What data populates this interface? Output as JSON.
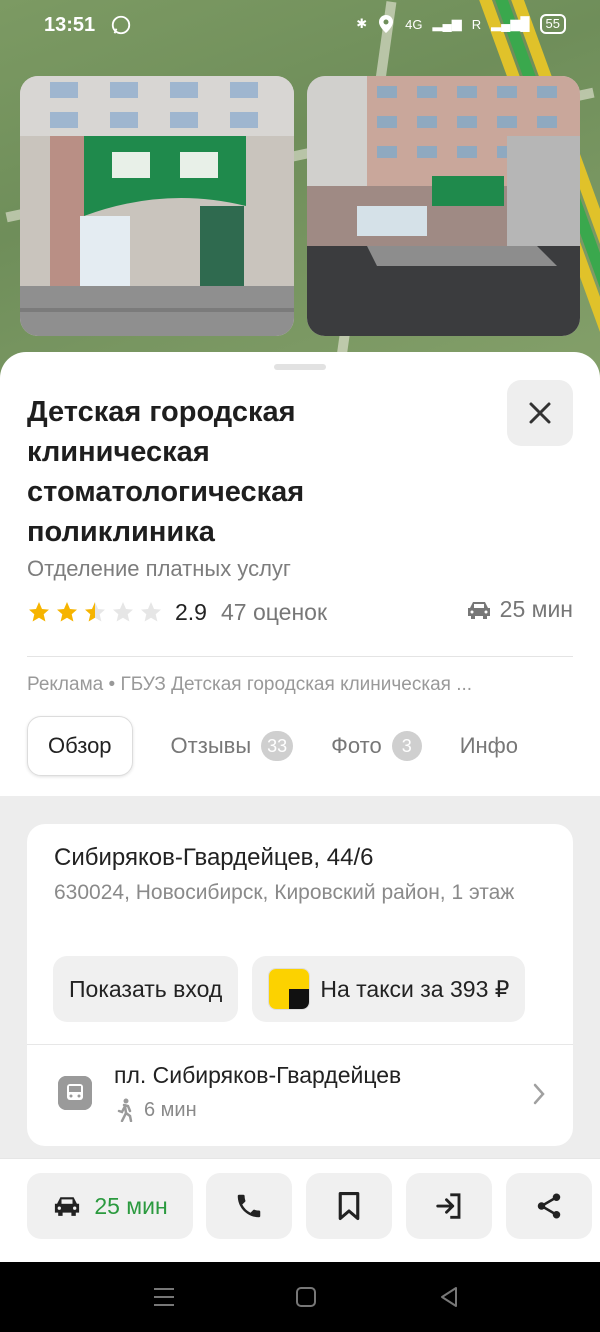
{
  "status_bar": {
    "time": "13:51",
    "network": "4G",
    "roaming": "R",
    "battery": "55"
  },
  "place": {
    "title": "Детская городская клиническая стоматологическая поликлиника",
    "subtitle": "Отделение платных услуг",
    "rating": "2.9",
    "rating_value": 2.5,
    "reviews": "47 оценок",
    "eta": "25 мин"
  },
  "ad": {
    "label": "Реклама",
    "text": "ГБУЗ Детская городская клиническая ..."
  },
  "tabs": [
    {
      "label": "Обзор"
    },
    {
      "label": "Отзывы",
      "badge": "33"
    },
    {
      "label": "Фото",
      "badge": "3"
    },
    {
      "label": "Инфо"
    }
  ],
  "address": {
    "street": "Сибиряков-Гвардейцев, 44/6",
    "details": "630024, Новосибирск, Кировский район, 1 этаж",
    "show_entrance": "Показать вход",
    "taxi": "На такси за 393 ₽"
  },
  "transit": {
    "stop": "пл. Сибиряков-Гвардейцев",
    "walk_time": "6 мин"
  },
  "bottom_bar": {
    "route_time": "25 мин"
  },
  "colors": {
    "accent_green": "#2b9a3f",
    "star": "#f6b400",
    "badge": "#cfcfcf"
  }
}
